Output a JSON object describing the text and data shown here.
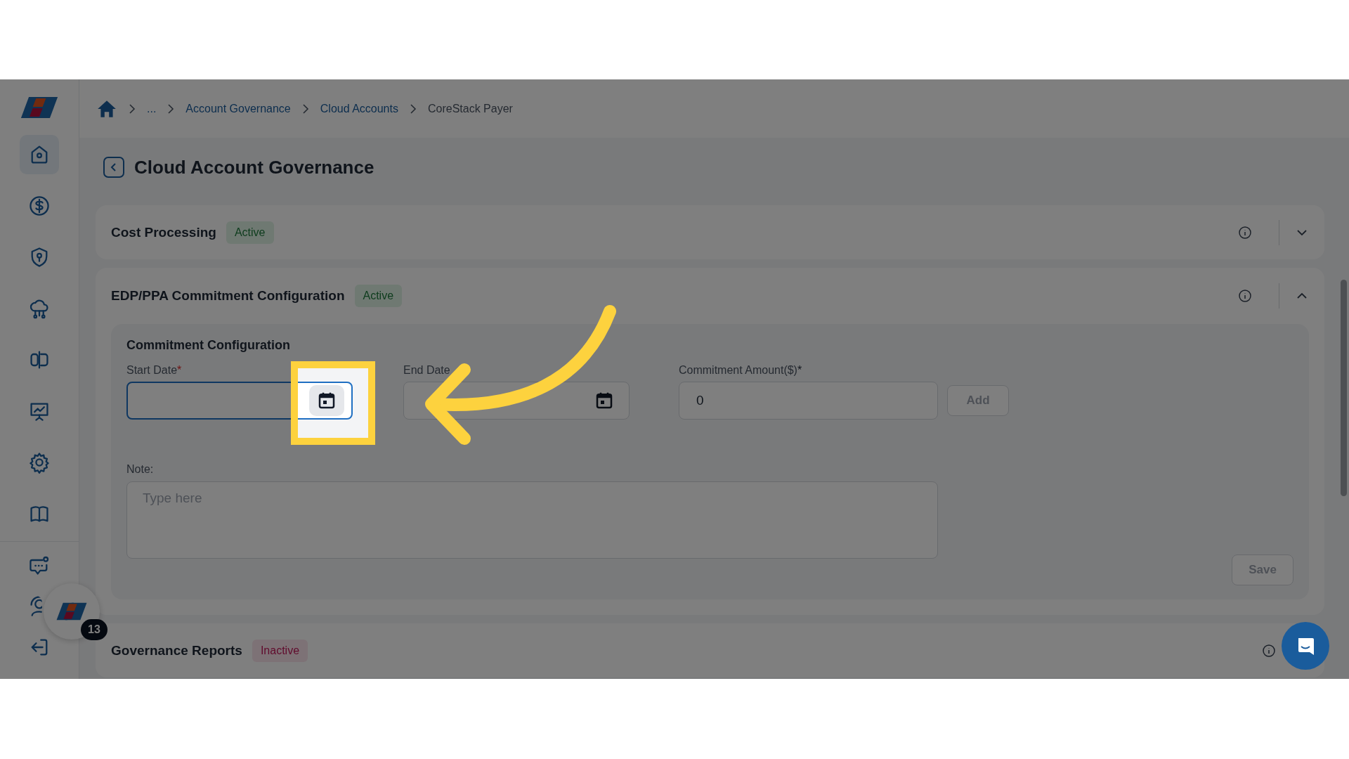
{
  "sidebar": {
    "items": [
      {
        "kind": "home",
        "selected": true
      },
      {
        "kind": "dollar",
        "selected": false
      },
      {
        "kind": "shield",
        "selected": false
      },
      {
        "kind": "cloud",
        "selected": false
      },
      {
        "kind": "split",
        "selected": false
      },
      {
        "kind": "presentation",
        "selected": false
      },
      {
        "kind": "gear",
        "selected": false
      },
      {
        "kind": "book",
        "selected": false
      }
    ],
    "bottom_items": [
      {
        "kind": "chat",
        "selected": false
      },
      {
        "kind": "support",
        "selected": false
      },
      {
        "kind": "logout",
        "selected": false
      }
    ]
  },
  "breadcrumb": [
    {
      "kind": "home"
    },
    {
      "kind": "link",
      "label": "..."
    },
    {
      "kind": "link",
      "label": "Account Governance"
    },
    {
      "kind": "link",
      "label": "Cloud Accounts"
    },
    {
      "kind": "current",
      "label": "CoreStack Payer"
    }
  ],
  "page_title": "Cloud Account Governance",
  "sections": [
    {
      "title": "Cost Processing",
      "status": "Active",
      "active": true,
      "expanded": false
    },
    {
      "title": "EDP/PPA Commitment Configuration",
      "status": "Active",
      "active": true,
      "expanded": true,
      "form": {
        "heading": "Commitment Configuration",
        "start_date": {
          "label": "Start Date",
          "required_mark": "*",
          "focused": true
        },
        "end_date": {
          "label": "End Date",
          "focused": false
        },
        "amount": {
          "label": "Commitment Amount($)",
          "required_mark": "*",
          "value": "0"
        },
        "add_button": {
          "label": "Add",
          "disabled": true
        },
        "note": {
          "label": "Note:",
          "placeholder": "Type here"
        },
        "save_button": {
          "label": "Save",
          "disabled": true
        }
      }
    },
    {
      "title": "Governance Reports",
      "status": "Inactive",
      "active": false
    }
  ],
  "floating_widget": {
    "badge": "13"
  }
}
